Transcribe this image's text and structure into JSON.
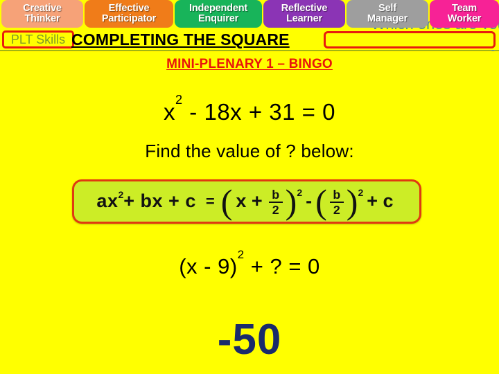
{
  "slide": {
    "background_color": "#FFFF00"
  },
  "plt_pills": [
    {
      "id": "creative",
      "line1": "Creative",
      "line2": "Thinker",
      "color": "#F6A278"
    },
    {
      "id": "effective",
      "line1": "Effective",
      "line2": "Participator",
      "color": "#F07C19"
    },
    {
      "id": "independent",
      "line1": "Independent",
      "line2": "Enquirer",
      "color": "#18B45A"
    },
    {
      "id": "reflective",
      "line1": "Reflective",
      "line2": "Learner",
      "color": "#8B34B5"
    },
    {
      "id": "self",
      "line1": "Self",
      "line2": "Manager",
      "color": "#9E9E9E"
    },
    {
      "id": "team",
      "line1": "Team",
      "line2": "Worker",
      "color": "#F72296"
    }
  ],
  "overlay": {
    "which_ones": "Which ones are you using?",
    "color": "#3F7F9F"
  },
  "header": {
    "plt_skills_label": "PLT Skills",
    "plt_skills_color": "#7D9B28",
    "title": "COMPLETING THE SQUARE",
    "title_color": "#000000",
    "border_color": "#E81C0E"
  },
  "subtitle": {
    "text": "MINI-PLENARY 1 – BINGO",
    "color": "#E8140C"
  },
  "equation_one": {
    "base": "x",
    "exponent": "2",
    "rest": " - 18x + 31 = 0"
  },
  "prompt": {
    "text": "Find the value of ? below:"
  },
  "formula": {
    "lhs": "ax",
    "lhs_exponent": "2",
    "lhs_rest": " + bx + c",
    "equals": "=",
    "paren_open_1": "(",
    "inside_1": "x +",
    "frac1_num": "b",
    "frac1_den": "2",
    "paren_close_1": ")",
    "exp_1": "2",
    "minus": "-",
    "paren_open_2": "(",
    "frac2_num": "b",
    "frac2_den": "2",
    "paren_close_2": ")",
    "exp_2": "2",
    "plus_c": "+ c",
    "background_color": "#CCED26",
    "border_color": "#E03A10"
  },
  "equation_two": {
    "prefix": "(x - 9)",
    "exponent": "2",
    "suffix": " + ? = 0"
  },
  "final_answer": {
    "value": "-50",
    "color": "#1A2B6B"
  }
}
